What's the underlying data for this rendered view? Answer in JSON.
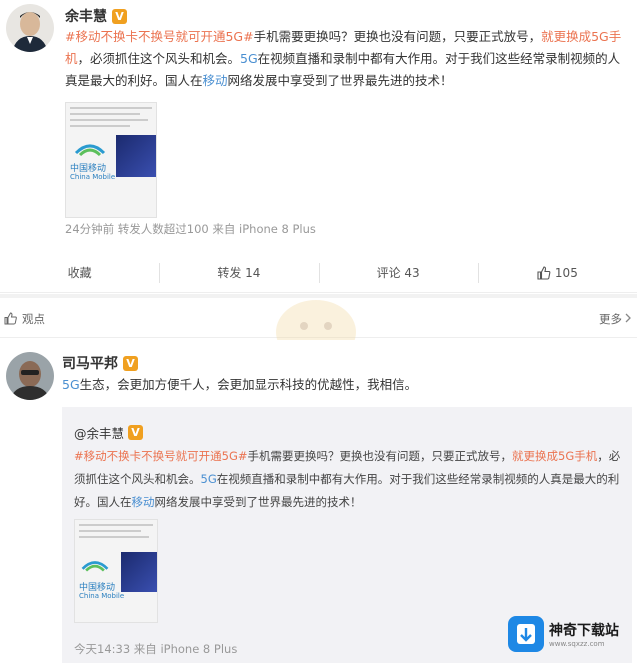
{
  "post1": {
    "author": "余丰慧",
    "text_parts": [
      {
        "t": "#移动不换卡不换号就可开通5G#",
        "c": "link"
      },
      {
        "t": "手机需要更换吗？更换也没有问题，只要正式放号，",
        "c": ""
      },
      {
        "t": "就更换成5G手机",
        "c": "link"
      },
      {
        "t": "，必须抓住这个风头和机会。",
        "c": ""
      },
      {
        "t": "5G",
        "c": "blue"
      },
      {
        "t": "在视频直播和录制中都有大作用。对于我们这些经常录制视频的人真是最大的利好。国人在",
        "c": ""
      },
      {
        "t": "移动",
        "c": "blue"
      },
      {
        "t": "网络发展中享受到了世界最先进的技术！",
        "c": ""
      }
    ],
    "thumb_brand_cn": "中国移动",
    "thumb_brand_en": "China Mobile",
    "meta": "24分钟前 转发人数超过100 来自 iPhone 8 Plus",
    "actions": {
      "favorite": "收藏",
      "repost": "转发 14",
      "comment": "评论 43",
      "like": "105"
    }
  },
  "divider": {
    "left_label": "观点",
    "right_label": "更多"
  },
  "post2": {
    "author": "司马平邦",
    "text_parts": [
      {
        "t": "5G",
        "c": "blue"
      },
      {
        "t": "生态，会更加方便千人，会更加显示科技的优越性，我相信。",
        "c": ""
      }
    ],
    "quote": {
      "author": "@余丰慧",
      "text_parts": [
        {
          "t": "#移动不换卡不换号就可开通5G#",
          "c": "link"
        },
        {
          "t": "手机需要更换吗？更换也没有问题，只要正式放号，",
          "c": ""
        },
        {
          "t": "就更换成5G手机",
          "c": "link"
        },
        {
          "t": "，必须抓住这个风头和机会。",
          "c": ""
        },
        {
          "t": "5G",
          "c": "blue"
        },
        {
          "t": "在视频直播和录制中都有大作用。对于我们这些经常录制视频的人真是最大的利好。国人在",
          "c": ""
        },
        {
          "t": "移动",
          "c": "blue"
        },
        {
          "t": "网络发展中享受到了世界最先进的技术！",
          "c": ""
        }
      ],
      "thumb_brand_cn": "中国移动",
      "thumb_brand_en": "China Mobile",
      "meta": "今天14:33 来自 iPhone 8 Plus"
    }
  },
  "watermark": {
    "site_name": "神奇下载站",
    "site_url": "www.sqxzz.com"
  },
  "colors": {
    "link": "#eb7350",
    "blue": "#4a8fd1",
    "badge": "#f0a020"
  }
}
